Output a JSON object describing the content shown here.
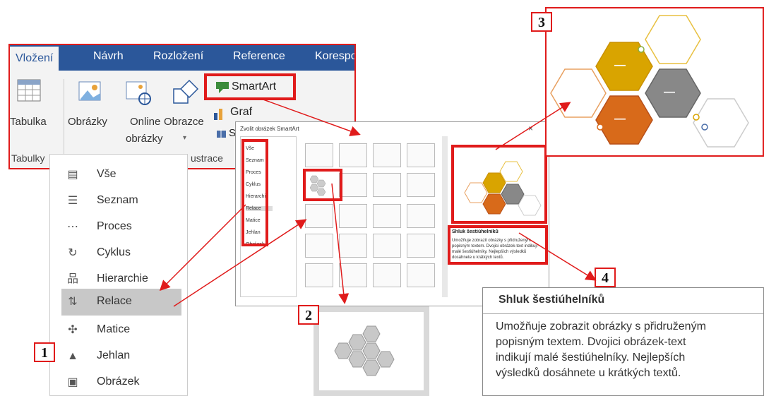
{
  "ribbon": {
    "tabs": [
      "Vložení",
      "Návrh",
      "Rozložení",
      "Reference",
      "Korespo"
    ],
    "tabulka_label": "Tabulka",
    "obrazky_label": "Obrázky",
    "online_label_1": "Online",
    "online_label_2": "obrázky",
    "obrazce_label": "Obrazce",
    "smartart_label": "SmartArt",
    "graf_label": "Graf",
    "group_tabulky": "Tabulky",
    "group_ilustrace": "ustrace",
    "screenshot_partial": "S"
  },
  "categories": [
    {
      "label": "Vše",
      "icon": "all-icon"
    },
    {
      "label": "Seznam",
      "icon": "list-icon"
    },
    {
      "label": "Proces",
      "icon": "process-icon"
    },
    {
      "label": "Cyklus",
      "icon": "cycle-icon"
    },
    {
      "label": "Hierarchie",
      "icon": "hierarchy-icon"
    },
    {
      "label": "Relace",
      "icon": "relationship-icon"
    },
    {
      "label": "Matice",
      "icon": "matrix-icon"
    },
    {
      "label": "Jehlan",
      "icon": "pyramid-icon"
    },
    {
      "label": "Obrázek",
      "icon": "picture-icon"
    }
  ],
  "dialog": {
    "title": "Zvolit obrázek SmartArt",
    "close": "×",
    "categories": [
      "Vše",
      "Seznam",
      "Proces",
      "Cyklus",
      "Hierarchie",
      "Relace",
      "Matice",
      "Jehlan",
      "Obrázek"
    ],
    "preview_title": "Shluk šestiúhelníků",
    "preview_desc": "Umožňuje zobrazit obrázky s přidruženým popisným textem. Dvojici obrázek-text indikují malé šestiúhelníky. Nejlepších výsledků dosáhnete u krátkých textů."
  },
  "tooltip": {
    "title": "Shluk šestiúhelníků",
    "line1": "Umožňuje zobrazit obrázky s přidruženým",
    "line2": "popisným textem. Dvojici obrázek-text",
    "line3": "indikují malé šestiúhelníky. Nejlepších",
    "line4": "výsledků dosáhnete u krátkých textů."
  },
  "markers": [
    "1",
    "2",
    "3",
    "4"
  ],
  "hex_dash": "—",
  "colors": {
    "accent_red": "#e01b1b",
    "ribbon_blue": "#2b579a",
    "gold": "#c9a000",
    "gray": "#7a7a7a",
    "orange": "#d86a1a"
  }
}
